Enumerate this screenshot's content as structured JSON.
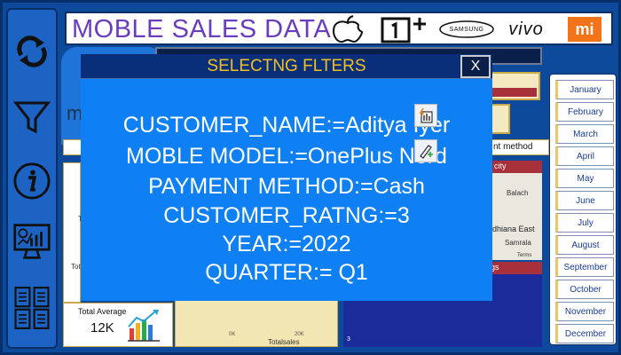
{
  "title": "MOBLE SALES DATA",
  "brands": {
    "samsung": "SAMSUNG",
    "vivo": "vivo",
    "mi": "mi"
  },
  "nav": [
    {
      "icon": "refresh-icon"
    },
    {
      "icon": "filter-icon"
    },
    {
      "icon": "info-icon"
    },
    {
      "icon": "dashboard-icon"
    },
    {
      "icon": "report-icon"
    }
  ],
  "modal": {
    "title": "SELECTNG FLTERS",
    "close": "X",
    "lines": [
      "CUSTOMER_NAME:=Aditya Iyer",
      "MOBLE MODEL:=OnePlus Nord",
      "PAYMENT METHOD:=Cash",
      "CUSTOMER_RATNG:=3",
      "YEAR:=2022",
      "QUARTER:= Q1"
    ]
  },
  "months": [
    "January",
    "February",
    "March",
    "April",
    "May",
    "June",
    "July",
    "August",
    "September",
    "October",
    "November",
    "December"
  ],
  "background": {
    "payment_label": "nt method",
    "city_label": "city",
    "map_labels": [
      "Balach",
      "dhiana East",
      "Samrala",
      "Terms"
    ],
    "total_average_label": "Total Average",
    "total_average_value": "12K",
    "axis_ticks": [
      "0K",
      "20K"
    ],
    "axis_title": "Totalsales",
    "small_m": "m",
    "tot_labels": [
      "Tot",
      "Tota"
    ],
    "bottom_value": "3",
    "gs_label": "gs"
  },
  "colors": {
    "accent": "#0f80f4",
    "title": "#6a3dbd",
    "modal_title": "#f0c020",
    "nav": "#1c63c4"
  }
}
